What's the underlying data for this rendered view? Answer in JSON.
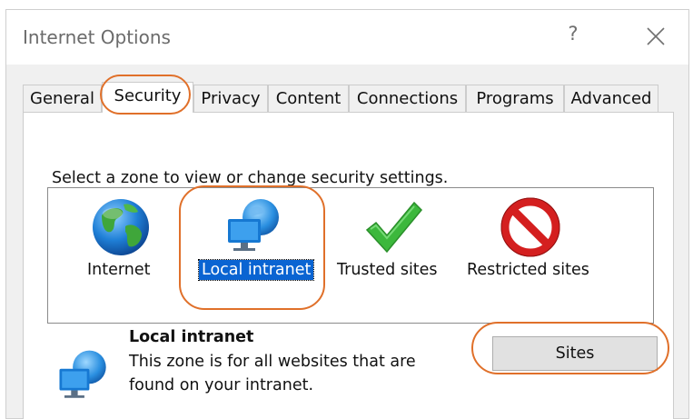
{
  "window": {
    "title": "Internet Options",
    "help_glyph": "?",
    "close_icon": "close-icon"
  },
  "tabs": [
    {
      "label": "General",
      "active": false
    },
    {
      "label": "Security",
      "active": true
    },
    {
      "label": "Privacy",
      "active": false
    },
    {
      "label": "Content",
      "active": false
    },
    {
      "label": "Connections",
      "active": false
    },
    {
      "label": "Programs",
      "active": false
    },
    {
      "label": "Advanced",
      "active": false
    }
  ],
  "security": {
    "prompt": "Select a zone to view or change security settings.",
    "zones": [
      {
        "label": "Internet",
        "icon": "globe-icon",
        "selected": false
      },
      {
        "label": "Local intranet",
        "icon": "intranet-icon",
        "selected": true
      },
      {
        "label": "Trusted sites",
        "icon": "checkmark-icon",
        "selected": false
      },
      {
        "label": "Restricted sites",
        "icon": "no-entry-icon",
        "selected": false
      }
    ],
    "info": {
      "title": "Local intranet",
      "description": "This zone is for all websites that are found on your intranet.",
      "icon": "intranet-icon"
    },
    "sites_button": "Sites"
  },
  "colors": {
    "annotation": "#e0702a",
    "selection": "#0a64d2",
    "dialog_bg": "#f0f0f0"
  }
}
